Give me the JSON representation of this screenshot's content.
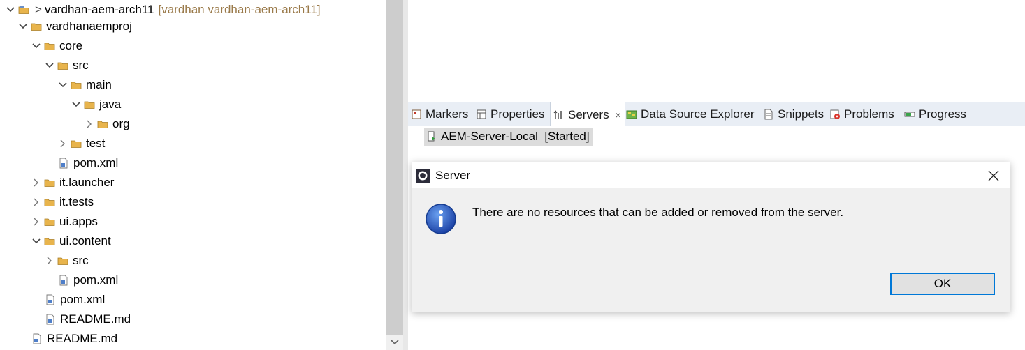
{
  "explorer": {
    "project": {
      "name": "vardhan-aem-arch11",
      "extra": "[vardhan vardhan-aem-arch11]",
      "prefix": ">"
    },
    "items": [
      {
        "label": "vardhanaemproj"
      },
      {
        "label": "core"
      },
      {
        "label": "src"
      },
      {
        "label": "main"
      },
      {
        "label": "java"
      },
      {
        "label": "org"
      },
      {
        "label": "test"
      },
      {
        "label": "pom.xml"
      },
      {
        "label": "it.launcher"
      },
      {
        "label": "it.tests"
      },
      {
        "label": "ui.apps"
      },
      {
        "label": "ui.content"
      },
      {
        "label": "src"
      },
      {
        "label": "pom.xml"
      },
      {
        "label": "pom.xml"
      },
      {
        "label": "README.md"
      },
      {
        "label": "README.md"
      }
    ]
  },
  "views": {
    "tabs": [
      {
        "label": "Markers",
        "icon": "markers-icon"
      },
      {
        "label": "Properties",
        "icon": "properties-icon"
      },
      {
        "label": "Servers",
        "icon": "servers-icon",
        "active": true
      },
      {
        "label": "Data Source Explorer",
        "icon": "data-source-icon"
      },
      {
        "label": "Snippets",
        "icon": "snippets-icon"
      },
      {
        "label": "Problems",
        "icon": "problems-icon"
      },
      {
        "label": "Progress",
        "icon": "progress-icon"
      }
    ],
    "close_glyph": "⨯"
  },
  "servers": {
    "entry": "AEM-Server-Local  [Started]"
  },
  "dialog": {
    "title": "Server",
    "message": "There are no resources that can be added or removed from the server.",
    "ok_label": "OK",
    "accent": "#0078d7"
  },
  "colors": {
    "folder": "#e8b44c",
    "selection": "#dcdcdc",
    "info_blue": "#1f4fb3"
  }
}
